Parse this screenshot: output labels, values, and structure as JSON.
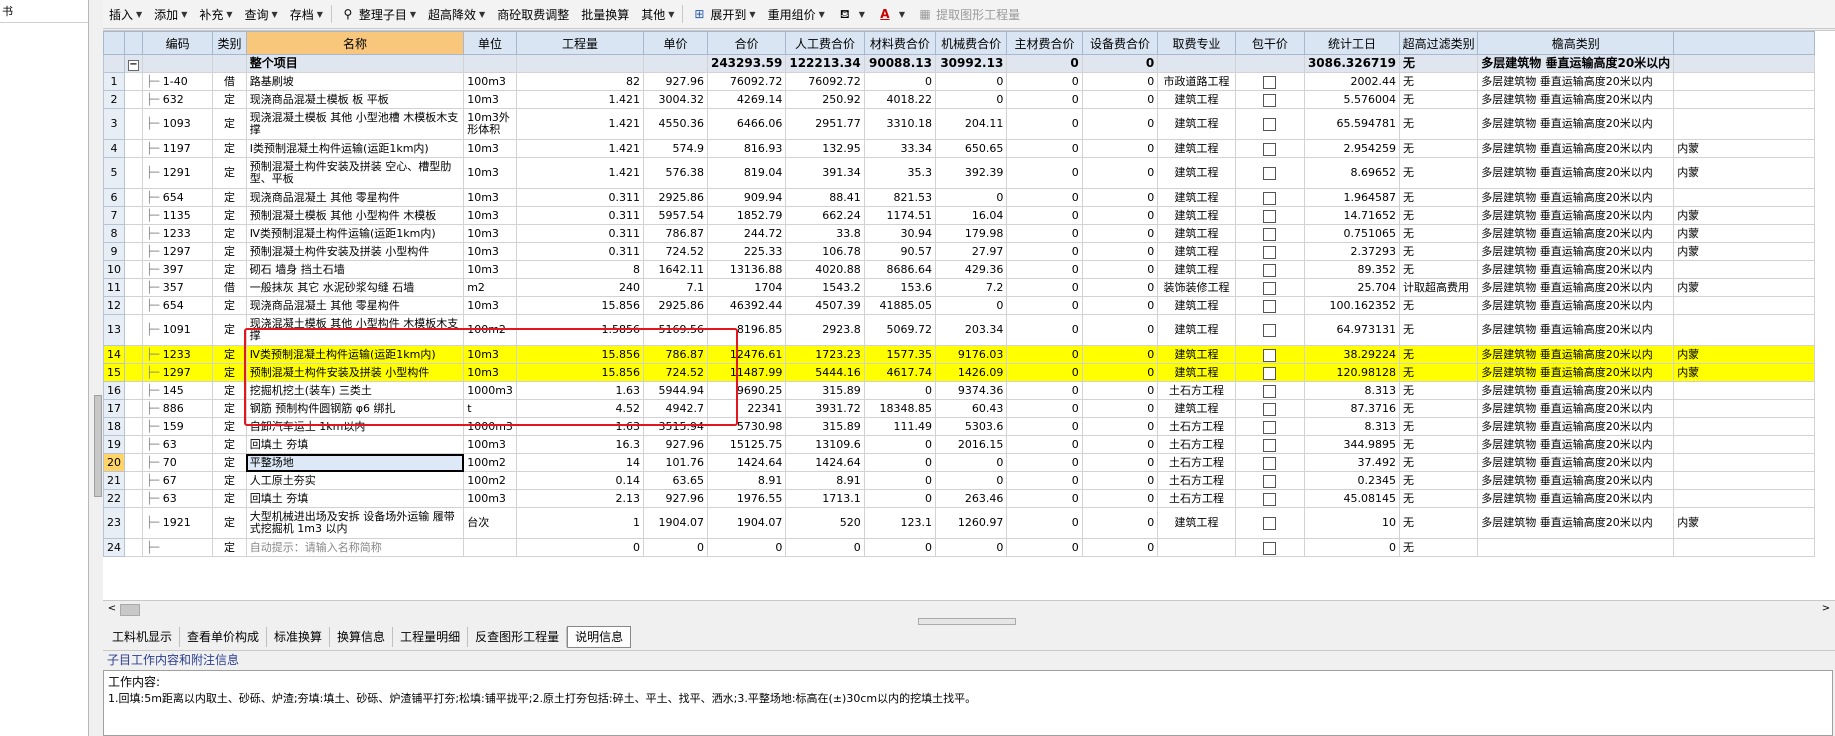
{
  "left_panel": {
    "title": "书"
  },
  "toolbar": {
    "items": [
      {
        "label": "插入",
        "arrow": true
      },
      {
        "label": "添加",
        "arrow": true
      },
      {
        "label": "补充",
        "arrow": true
      },
      {
        "label": "查询",
        "arrow": true
      },
      {
        "label": "存档",
        "arrow": true
      },
      {
        "label": "整理子目",
        "arrow": true
      },
      {
        "label": "超高降效",
        "arrow": true
      },
      {
        "label": "商砼取费调整",
        "arrow": false
      },
      {
        "label": "批量换算",
        "arrow": false
      },
      {
        "label": "其他",
        "arrow": true
      },
      {
        "label": "展开到",
        "arrow": true
      },
      {
        "label": "重用组价",
        "arrow": true
      },
      {
        "label": "提取图形工程量",
        "arrow": false
      }
    ]
  },
  "grid": {
    "columns": [
      "编码",
      "类别",
      "名称",
      "单位",
      "工程量",
      "单价",
      "合价",
      "人工费合价",
      "材料费合价",
      "机械费合价",
      "主材费合价",
      "设备费合价",
      "取费专业",
      "包干价",
      "统计工日",
      "超高过滤类别",
      "檐高类别"
    ],
    "summary": {
      "name": "整个项目",
      "total": "243293.59",
      "labor": "122213.34",
      "material": "90088.13",
      "machine": "30992.13",
      "main_mat": "0",
      "equip": "0",
      "workdays": "3086.326719",
      "height": "无",
      "eave": "多层建筑物 垂直运输高度20米以内"
    },
    "rows": [
      {
        "n": "1",
        "code": "1-40",
        "type": "借",
        "name": "路基刷坡",
        "unit": "100m3",
        "qty": "82",
        "price": "927.96",
        "total": "76092.72",
        "labor": "76092.72",
        "mat": "0",
        "mach": "0",
        "main": "0",
        "equip": "0",
        "fee": "市政道路工程",
        "wd": "2002.44",
        "hf": "无",
        "eave": "多层建筑物 垂直运输高度20米以内",
        "x": ""
      },
      {
        "n": "2",
        "code": "632",
        "type": "定",
        "name": "现浇商品混凝土模板 板 平板",
        "unit": "10m3",
        "qty": "1.421",
        "price": "3004.32",
        "total": "4269.14",
        "labor": "250.92",
        "mat": "4018.22",
        "mach": "0",
        "main": "0",
        "equip": "0",
        "fee": "建筑工程",
        "wd": "5.576004",
        "hf": "无",
        "eave": "多层建筑物 垂直运输高度20米以内",
        "x": ""
      },
      {
        "n": "3",
        "code": "1093",
        "type": "定",
        "name": "现浇混凝土模板 其他 小型池槽 木模板木支撑",
        "unit": "10m3外形体积",
        "qty": "1.421",
        "price": "4550.36",
        "total": "6466.06",
        "labor": "2951.77",
        "mat": "3310.18",
        "mach": "204.11",
        "main": "0",
        "equip": "0",
        "fee": "建筑工程",
        "wd": "65.594781",
        "hf": "无",
        "eave": "多层建筑物 垂直运输高度20米以内",
        "x": "",
        "tall": true
      },
      {
        "n": "4",
        "code": "1197",
        "type": "定",
        "name": "Ⅰ类预制混凝土构件运输(运距1km内)",
        "unit": "10m3",
        "qty": "1.421",
        "price": "574.9",
        "total": "816.93",
        "labor": "132.95",
        "mat": "33.34",
        "mach": "650.65",
        "main": "0",
        "equip": "0",
        "fee": "建筑工程",
        "wd": "2.954259",
        "hf": "无",
        "eave": "多层建筑物 垂直运输高度20米以内",
        "x": "内蒙"
      },
      {
        "n": "5",
        "code": "1291",
        "type": "定",
        "name": "预制混凝土构件安装及拼装 空心、槽型肋型、平板",
        "unit": "10m3",
        "qty": "1.421",
        "price": "576.38",
        "total": "819.04",
        "labor": "391.34",
        "mat": "35.3",
        "mach": "392.39",
        "main": "0",
        "equip": "0",
        "fee": "建筑工程",
        "wd": "8.69652",
        "hf": "无",
        "eave": "多层建筑物 垂直运输高度20米以内",
        "x": "内蒙",
        "tall": true
      },
      {
        "n": "6",
        "code": "654",
        "type": "定",
        "name": "现浇商品混凝土 其他 零星构件",
        "unit": "10m3",
        "qty": "0.311",
        "price": "2925.86",
        "total": "909.94",
        "labor": "88.41",
        "mat": "821.53",
        "mach": "0",
        "main": "0",
        "equip": "0",
        "fee": "建筑工程",
        "wd": "1.964587",
        "hf": "无",
        "eave": "多层建筑物 垂直运输高度20米以内",
        "x": ""
      },
      {
        "n": "7",
        "code": "1135",
        "type": "定",
        "name": "预制混凝土模板 其他 小型构件 木模板",
        "unit": "10m3",
        "qty": "0.311",
        "price": "5957.54",
        "total": "1852.79",
        "labor": "662.24",
        "mat": "1174.51",
        "mach": "16.04",
        "main": "0",
        "equip": "0",
        "fee": "建筑工程",
        "wd": "14.71652",
        "hf": "无",
        "eave": "多层建筑物 垂直运输高度20米以内",
        "x": "内蒙"
      },
      {
        "n": "8",
        "code": "1233",
        "type": "定",
        "name": "Ⅳ类预制混凝土构件运输(运距1km内)",
        "unit": "10m3",
        "qty": "0.311",
        "price": "786.87",
        "total": "244.72",
        "labor": "33.8",
        "mat": "30.94",
        "mach": "179.98",
        "main": "0",
        "equip": "0",
        "fee": "建筑工程",
        "wd": "0.751065",
        "hf": "无",
        "eave": "多层建筑物 垂直运输高度20米以内",
        "x": "内蒙"
      },
      {
        "n": "9",
        "code": "1297",
        "type": "定",
        "name": "预制混凝土构件安装及拼装 小型构件",
        "unit": "10m3",
        "qty": "0.311",
        "price": "724.52",
        "total": "225.33",
        "labor": "106.78",
        "mat": "90.57",
        "mach": "27.97",
        "main": "0",
        "equip": "0",
        "fee": "建筑工程",
        "wd": "2.37293",
        "hf": "无",
        "eave": "多层建筑物 垂直运输高度20米以内",
        "x": "内蒙"
      },
      {
        "n": "10",
        "code": "397",
        "type": "定",
        "name": "砌石 墙身 挡土石墙",
        "unit": "10m3",
        "qty": "8",
        "price": "1642.11",
        "total": "13136.88",
        "labor": "4020.88",
        "mat": "8686.64",
        "mach": "429.36",
        "main": "0",
        "equip": "0",
        "fee": "建筑工程",
        "wd": "89.352",
        "hf": "无",
        "eave": "多层建筑物 垂直运输高度20米以内",
        "x": ""
      },
      {
        "n": "11",
        "code": "357",
        "type": "借",
        "name": "一般抹灰 其它 水泥砂浆勾缝 石墙",
        "unit": "m2",
        "qty": "240",
        "price": "7.1",
        "total": "1704",
        "labor": "1543.2",
        "mat": "153.6",
        "mach": "7.2",
        "main": "0",
        "equip": "0",
        "fee": "装饰装修工程",
        "wd": "25.704",
        "hf": "计取超高费用",
        "eave": "多层建筑物 垂直运输高度20米以内",
        "x": "内蒙"
      },
      {
        "n": "12",
        "code": "654",
        "type": "定",
        "name": "现浇商品混凝土 其他 零星构件",
        "unit": "10m3",
        "qty": "15.856",
        "price": "2925.86",
        "total": "46392.44",
        "labor": "4507.39",
        "mat": "41885.05",
        "mach": "0",
        "main": "0",
        "equip": "0",
        "fee": "建筑工程",
        "wd": "100.162352",
        "hf": "无",
        "eave": "多层建筑物 垂直运输高度20米以内",
        "x": ""
      },
      {
        "n": "13",
        "code": "1091",
        "type": "定",
        "name": "现浇混凝土模板 其他 小型构件 木模板木支撑",
        "unit": "100m2",
        "qty": "1.5856",
        "price": "5169.56",
        "total": "8196.85",
        "labor": "2923.8",
        "mat": "5069.72",
        "mach": "203.34",
        "main": "0",
        "equip": "0",
        "fee": "建筑工程",
        "wd": "64.973131",
        "hf": "无",
        "eave": "多层建筑物 垂直运输高度20米以内",
        "x": "",
        "tall": true
      },
      {
        "n": "14",
        "code": "1233",
        "type": "定",
        "name": "Ⅳ类预制混凝土构件运输(运距1km内)",
        "unit": "10m3",
        "qty": "15.856",
        "price": "786.87",
        "total": "12476.61",
        "labor": "1723.23",
        "mat": "1577.35",
        "mach": "9176.03",
        "main": "0",
        "equip": "0",
        "fee": "建筑工程",
        "wd": "38.29224",
        "hf": "无",
        "eave": "多层建筑物 垂直运输高度20米以内",
        "x": "内蒙",
        "hl": true
      },
      {
        "n": "15",
        "code": "1297",
        "type": "定",
        "name": "预制混凝土构件安装及拼装 小型构件",
        "unit": "10m3",
        "qty": "15.856",
        "price": "724.52",
        "total": "11487.99",
        "labor": "5444.16",
        "mat": "4617.74",
        "mach": "1426.09",
        "main": "0",
        "equip": "0",
        "fee": "建筑工程",
        "wd": "120.98128",
        "hf": "无",
        "eave": "多层建筑物 垂直运输高度20米以内",
        "x": "内蒙",
        "hl": true
      },
      {
        "n": "16",
        "code": "145",
        "type": "定",
        "name": "挖掘机挖土(装车) 三类土",
        "unit": "1000m3",
        "qty": "1.63",
        "price": "5944.94",
        "total": "9690.25",
        "labor": "315.89",
        "mat": "0",
        "mach": "9374.36",
        "main": "0",
        "equip": "0",
        "fee": "土石方工程",
        "wd": "8.313",
        "hf": "无",
        "eave": "多层建筑物 垂直运输高度20米以内",
        "x": ""
      },
      {
        "n": "17",
        "code": "886",
        "type": "定",
        "name": "钢筋 预制构件圆钢筋 φ6 绑扎",
        "unit": "t",
        "qty": "4.52",
        "price": "4942.7",
        "total": "22341",
        "labor": "3931.72",
        "mat": "18348.85",
        "mach": "60.43",
        "main": "0",
        "equip": "0",
        "fee": "建筑工程",
        "wd": "87.3716",
        "hf": "无",
        "eave": "多层建筑物 垂直运输高度20米以内",
        "x": ""
      },
      {
        "n": "18",
        "code": "159",
        "type": "定",
        "name": "自卸汽车运土 1km以内",
        "unit": "1000m3",
        "qty": "1.63",
        "price": "3515.94",
        "total": "5730.98",
        "labor": "315.89",
        "mat": "111.49",
        "mach": "5303.6",
        "main": "0",
        "equip": "0",
        "fee": "土石方工程",
        "wd": "8.313",
        "hf": "无",
        "eave": "多层建筑物 垂直运输高度20米以内",
        "x": ""
      },
      {
        "n": "19",
        "code": "63",
        "type": "定",
        "name": "回填土 夯填",
        "unit": "100m3",
        "qty": "16.3",
        "price": "927.96",
        "total": "15125.75",
        "labor": "13109.6",
        "mat": "0",
        "mach": "2016.15",
        "main": "0",
        "equip": "0",
        "fee": "土石方工程",
        "wd": "344.9895",
        "hf": "无",
        "eave": "多层建筑物 垂直运输高度20米以内",
        "x": ""
      },
      {
        "n": "20",
        "code": "70",
        "type": "定",
        "name": "平整场地",
        "unit": "100m2",
        "qty": "14",
        "price": "101.76",
        "total": "1424.64",
        "labor": "1424.64",
        "mat": "0",
        "mach": "0",
        "main": "0",
        "equip": "0",
        "fee": "土石方工程",
        "wd": "37.492",
        "hf": "无",
        "eave": "多层建筑物 垂直运输高度20米以内",
        "x": "",
        "cur": true
      },
      {
        "n": "21",
        "code": "67",
        "type": "定",
        "name": "人工原土夯实",
        "unit": "100m2",
        "qty": "0.14",
        "price": "63.65",
        "total": "8.91",
        "labor": "8.91",
        "mat": "0",
        "mach": "0",
        "main": "0",
        "equip": "0",
        "fee": "土石方工程",
        "wd": "0.2345",
        "hf": "无",
        "eave": "多层建筑物 垂直运输高度20米以内",
        "x": ""
      },
      {
        "n": "22",
        "code": "63",
        "type": "定",
        "name": "回填土 夯填",
        "unit": "100m3",
        "qty": "2.13",
        "price": "927.96",
        "total": "1976.55",
        "labor": "1713.1",
        "mat": "0",
        "mach": "263.46",
        "main": "0",
        "equip": "0",
        "fee": "土石方工程",
        "wd": "45.08145",
        "hf": "无",
        "eave": "多层建筑物 垂直运输高度20米以内",
        "x": ""
      },
      {
        "n": "23",
        "code": "1921",
        "type": "定",
        "name": "大型机械进出场及安拆 设备场外运输 履带式挖掘机 1m3 以内",
        "unit": "台次",
        "qty": "1",
        "price": "1904.07",
        "total": "1904.07",
        "labor": "520",
        "mat": "123.1",
        "mach": "1260.97",
        "main": "0",
        "equip": "0",
        "fee": "建筑工程",
        "wd": "10",
        "hf": "无",
        "eave": "多层建筑物 垂直运输高度20米以内",
        "x": "内蒙",
        "tall": true
      },
      {
        "n": "24",
        "code": "",
        "type": "定",
        "name": "自动提示：请输入名称简称",
        "unit": "",
        "qty": "0",
        "price": "0",
        "total": "0",
        "labor": "0",
        "mat": "0",
        "mach": "0",
        "main": "0",
        "equip": "0",
        "fee": "",
        "wd": "0",
        "hf": "无",
        "eave": "",
        "x": "",
        "hint": true
      }
    ]
  },
  "bottom_tabs": [
    "工料机显示",
    "查看单价构成",
    "标准换算",
    "换算信息",
    "工程量明细",
    "反查图形工程量",
    "说明信息"
  ],
  "active_tab_index": 6,
  "info": {
    "header": "子目工作内容和附注信息",
    "line1": "工作内容:",
    "line2": "1.回填:5m距离以内取土、砂砾、炉渣;夯填:填土、砂砾、炉渣铺平打夯;松填:铺平拢平;2.原土打夯包括:碎土、平土、找平、洒水;3.平整场地:标高在(±)30cm以内的挖填土找平。"
  }
}
